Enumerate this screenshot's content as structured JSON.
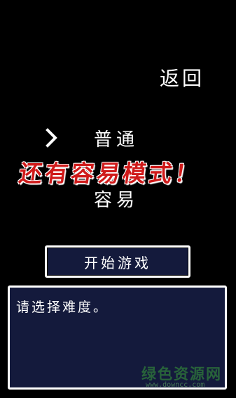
{
  "header": {
    "back_label": "返回"
  },
  "menu": {
    "cursor_icon": "chevron-right-icon",
    "options": [
      {
        "label": "普通",
        "selected": true
      },
      {
        "label": "容易",
        "selected": false
      }
    ]
  },
  "banner": {
    "text": "还有容易模式！",
    "color": "#cf1a1a"
  },
  "start_button": {
    "label": "开始游戏"
  },
  "dialog": {
    "message": "请选择难度。",
    "background": "#141a3c"
  },
  "watermark": {
    "title": "绿色资源网",
    "url": "www.downcc.com"
  }
}
